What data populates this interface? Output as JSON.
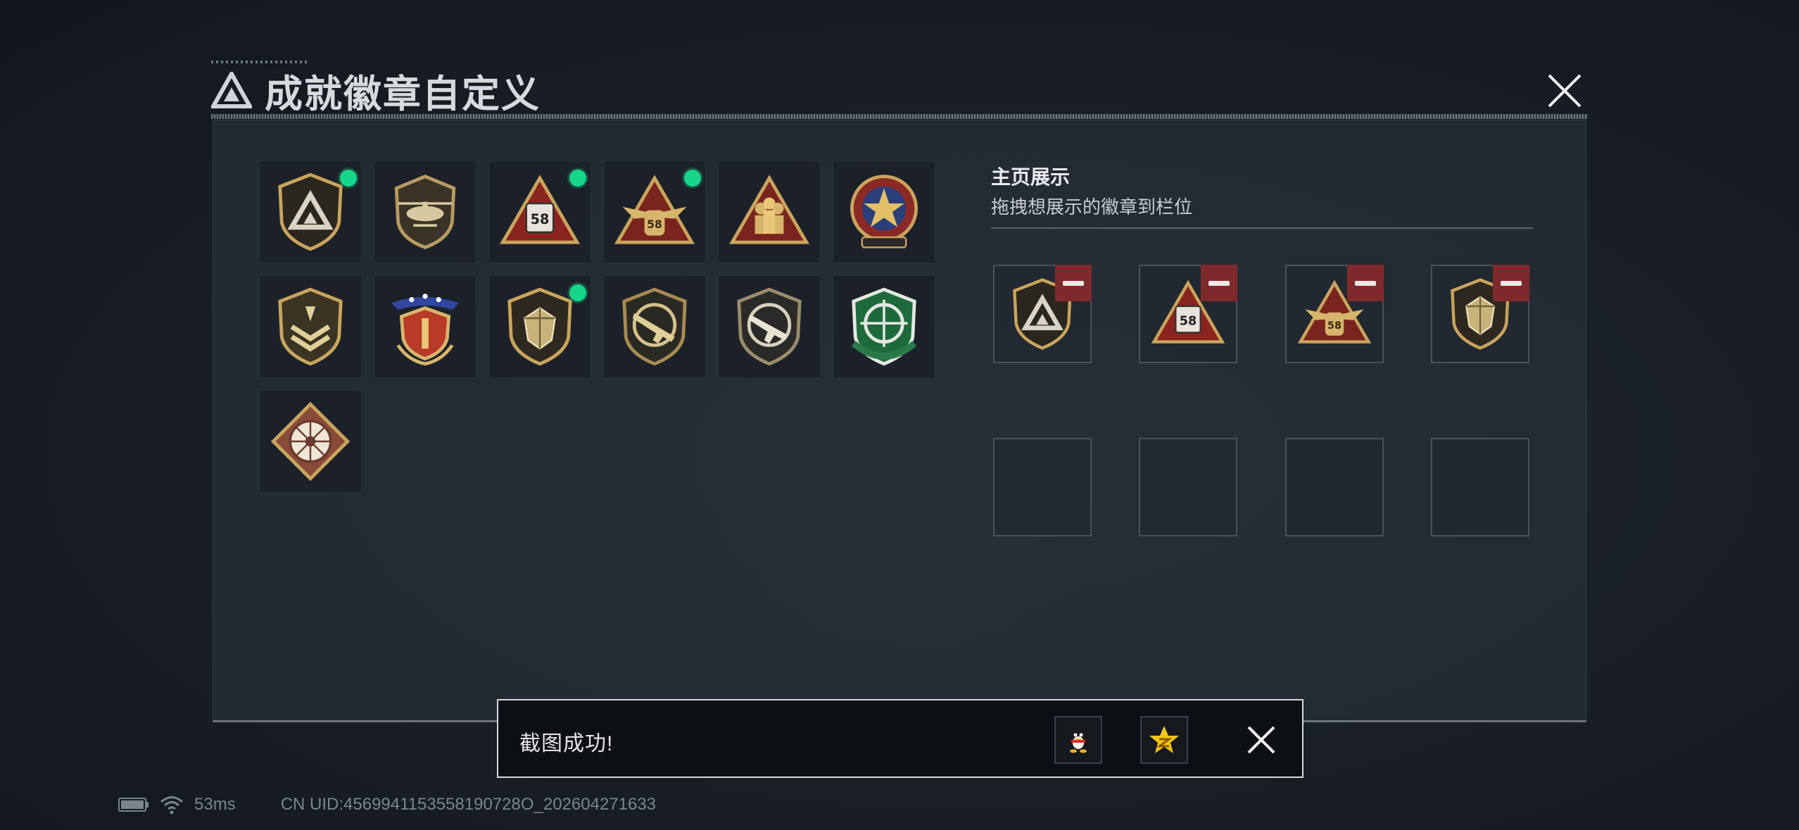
{
  "header": {
    "title": "成就徽章自定义",
    "logo": "triangle-logo-icon",
    "close": "close-icon"
  },
  "badge_grid": [
    {
      "id": "shield-triangle-badge",
      "new": true
    },
    {
      "id": "helicopter-badge",
      "new": false
    },
    {
      "id": "triangle-s8-badge",
      "new": true
    },
    {
      "id": "triangle-eagle-s8-badge",
      "new": true
    },
    {
      "id": "triangle-soldiers-badge",
      "new": false
    },
    {
      "id": "star-medal-badge",
      "new": false
    },
    {
      "id": "shield-chevron-badge",
      "new": false
    },
    {
      "id": "winged-stars-badge",
      "new": false
    },
    {
      "id": "gem-shield-badge",
      "new": true
    },
    {
      "id": "rifle-shield-badge",
      "new": false
    },
    {
      "id": "pistol-shield-badge",
      "new": false
    },
    {
      "id": "green-crosshair-badge",
      "new": false
    },
    {
      "id": "diamond-wheel-badge",
      "new": false
    }
  ],
  "showcase": {
    "title": "主页展示",
    "subtitle": "拖拽想展示的徽章到栏位",
    "slots": [
      "shield-triangle-badge",
      "triangle-s8-badge",
      "triangle-eagle-s8-badge",
      "gem-shield-badge",
      "",
      "",
      "",
      ""
    ]
  },
  "toast": {
    "message": "截图成功!",
    "buttons": [
      "qq-penguin-icon",
      "qzone-star-icon"
    ],
    "close": "close-icon"
  },
  "status_bar": {
    "ping": "53ms",
    "uid": "CN UID:4569941153558190728O_202604271633"
  },
  "colors": {
    "accent_new": "#17d68a",
    "remove": "#7e2a2c",
    "gold": "#c9a45c"
  }
}
